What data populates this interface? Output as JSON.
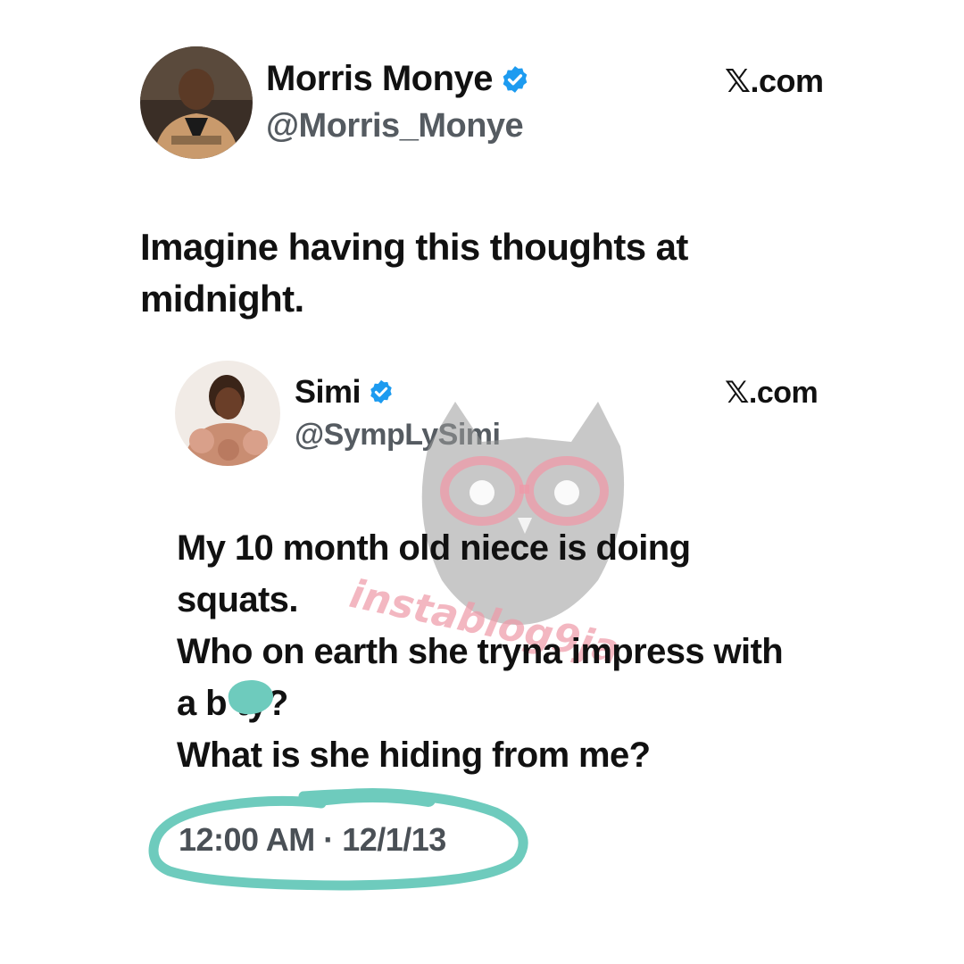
{
  "outer_tweet": {
    "display_name": "Morris Monye",
    "handle": "@Morris_Monye",
    "source": "𝕏.com",
    "text_lines": [
      "Imagine having this thoughts at",
      "midnight."
    ]
  },
  "quoted_tweet": {
    "display_name": "Simi",
    "handle": "@SympLySimi",
    "source": "𝕏.com",
    "text_lines": [
      "My 10 month old niece is doing",
      "squats.",
      "Who on earth she tryna impress with",
      "a b  ty?",
      "What is she hiding from me?"
    ],
    "timestamp": "12:00 AM · 12/1/13"
  },
  "watermark": {
    "text": "instablog9ja"
  },
  "colors": {
    "verified": "#1d9bf0",
    "highlight": "#6ecbbd",
    "watermark_pink": "#ef9aa8",
    "watermark_gray": "#9a9a9a"
  }
}
